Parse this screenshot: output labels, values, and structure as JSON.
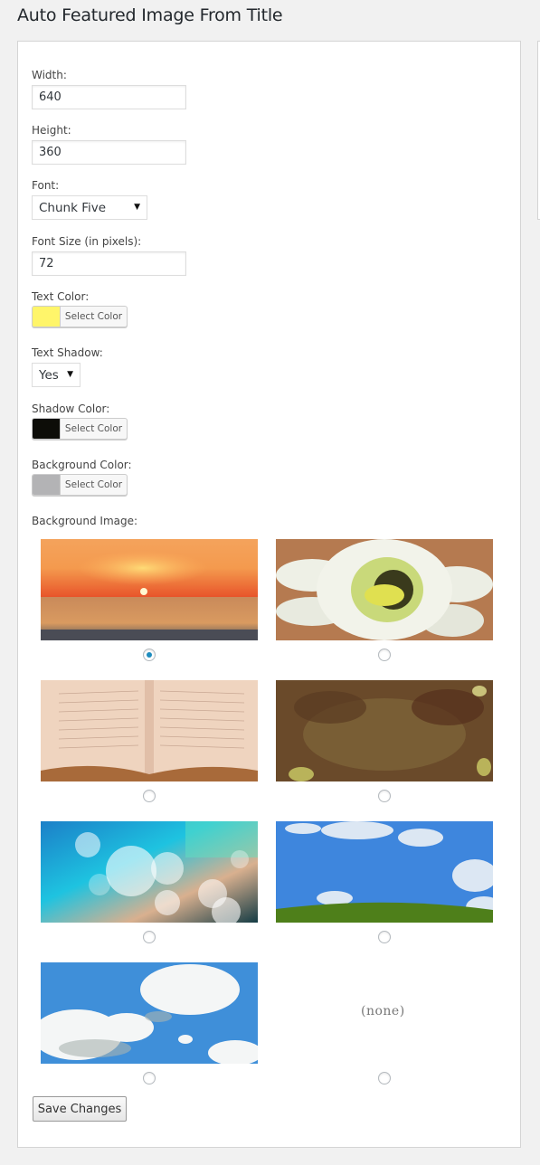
{
  "header": {
    "title": "Auto Featured Image From Title"
  },
  "form": {
    "width": {
      "label": "Width:",
      "value": "640"
    },
    "height": {
      "label": "Height:",
      "value": "360"
    },
    "font": {
      "label": "Font:",
      "selected": "Chunk Five"
    },
    "font_size": {
      "label": "Font Size (in pixels):",
      "value": "72"
    },
    "text_color": {
      "label": "Text Color:",
      "button": "Select Color",
      "color": "#fff56a"
    },
    "text_shadow": {
      "label": "Text Shadow:",
      "selected": "Yes"
    },
    "shadow_color": {
      "label": "Shadow Color:",
      "button": "Select Color",
      "color": "#0d0d08"
    },
    "background_color": {
      "label": "Background Color:",
      "button": "Select Color",
      "color": "#b3b3b5"
    },
    "background_image": {
      "label": "Background Image:",
      "options": [
        {
          "name": "sunset",
          "selected": true
        },
        {
          "name": "flower",
          "selected": false
        },
        {
          "name": "book",
          "selected": false
        },
        {
          "name": "grunge",
          "selected": false
        },
        {
          "name": "bokeh",
          "selected": false
        },
        {
          "name": "green-hill",
          "selected": false
        },
        {
          "name": "clouds",
          "selected": false
        },
        {
          "name": "none",
          "label": "(none)",
          "selected": false
        }
      ]
    },
    "save_label": "Save Changes"
  },
  "colors": {
    "accent": "#1e8cbe"
  }
}
